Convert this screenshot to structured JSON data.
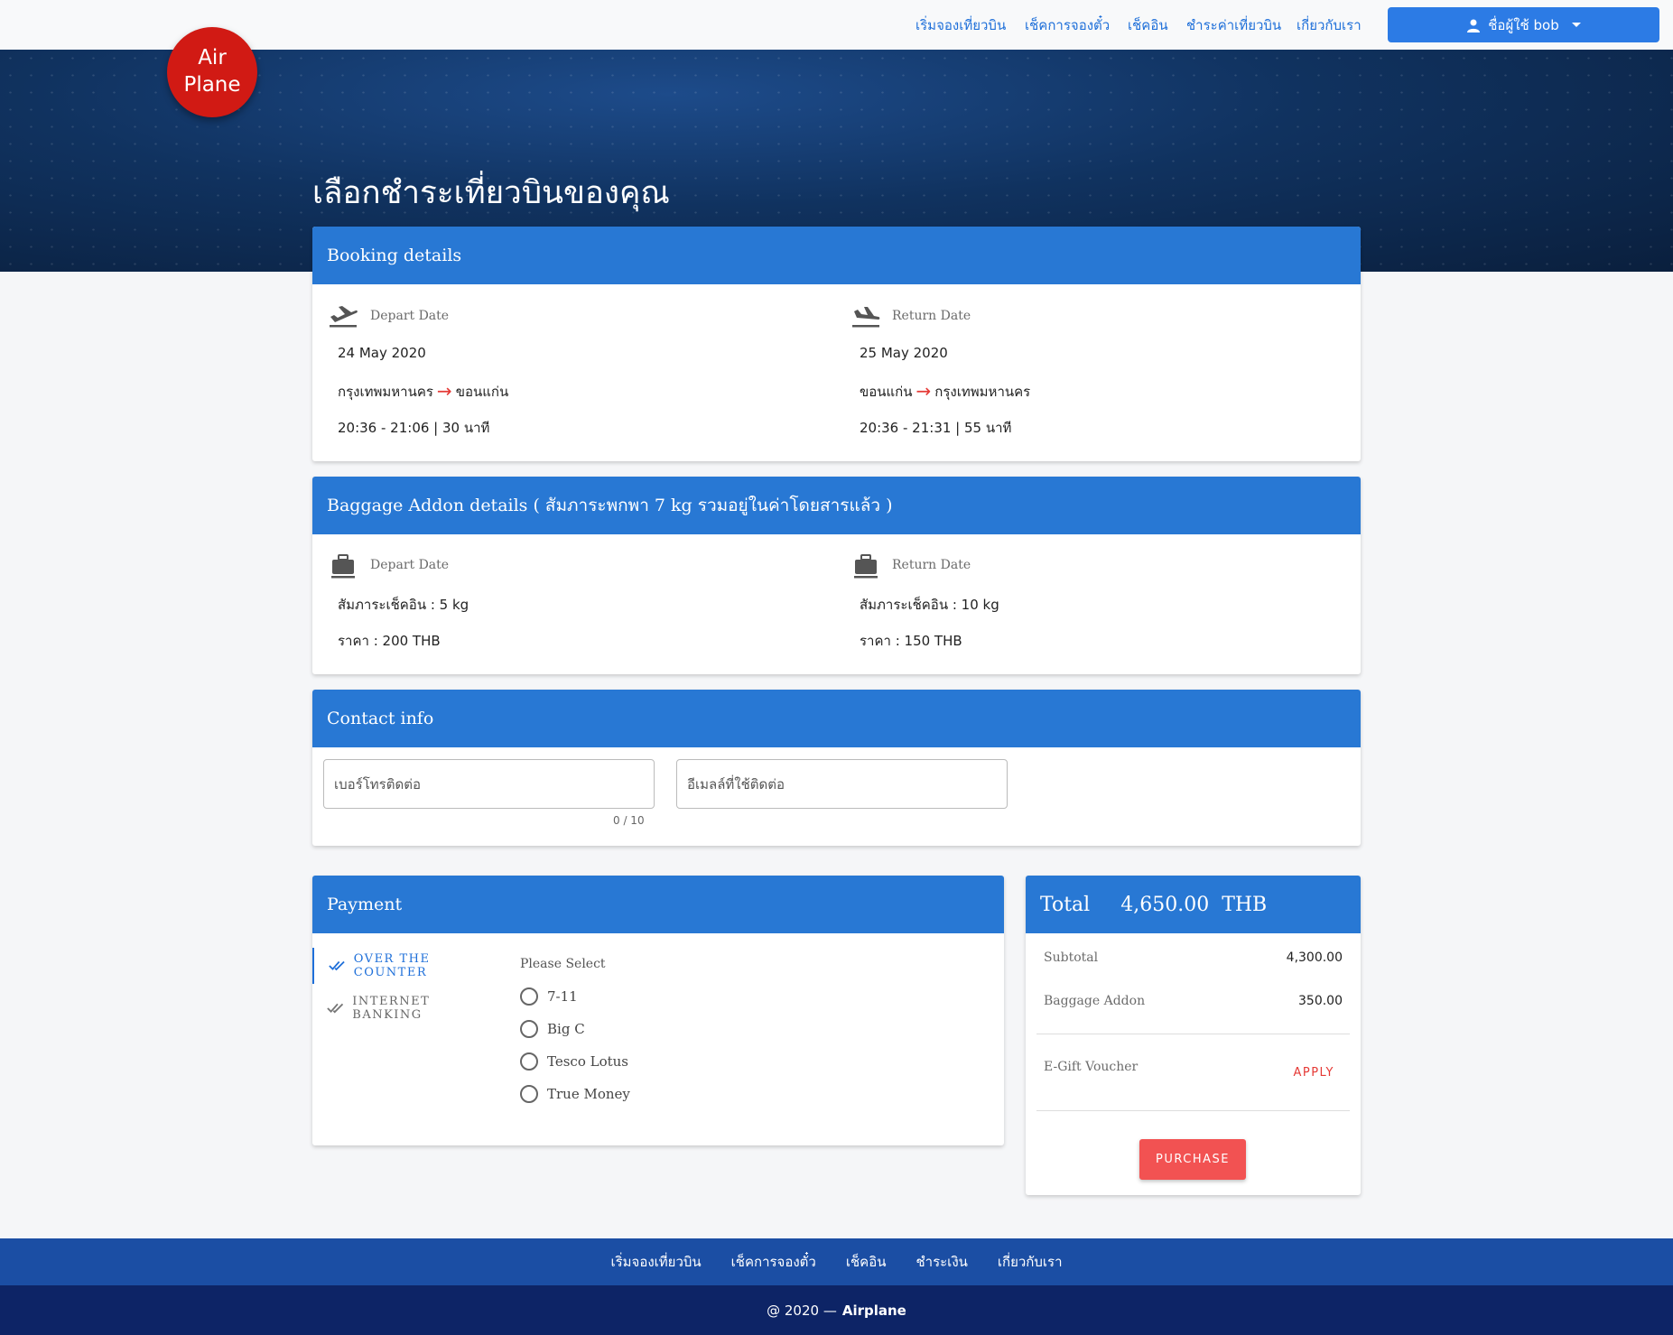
{
  "nav": {
    "links": [
      "เริ่มจองเที่ยวบิน",
      "เช็คการจองตั๋ว",
      "เช็คอิน",
      "ชำระค่าเที่ยวบิน",
      "เกี่ยวกับเรา"
    ],
    "user_label": "ชื่อผู้ใช้ bob"
  },
  "logo": {
    "line1": "Air",
    "line2": "Plane"
  },
  "page_title": "เลือกชำระเที่ยวบินของคุณ",
  "booking": {
    "title": "Booking details",
    "depart": {
      "label": "Depart Date",
      "date": "24 May 2020",
      "from": "กรุงเทพมหานคร",
      "to": "ขอนแก่น",
      "time": "20:36 - 21:06 | 30 นาที"
    },
    "return": {
      "label": "Return Date",
      "date": "25 May 2020",
      "from": "ขอนแก่น",
      "to": "กรุงเทพมหานคร",
      "time": "20:36 - 21:31 | 55 นาที"
    }
  },
  "baggage": {
    "title": "Baggage Addon details ( สัมภาระพกพา 7 kg รวมอยู่ในค่าโดยสารแล้ว )",
    "depart": {
      "label": "Depart Date",
      "weight": "สัมภาระเช็คอิน : 5 kg",
      "price": "ราคา : 200 THB"
    },
    "return": {
      "label": "Return Date",
      "weight": "สัมภาระเช็คอิน : 10 kg",
      "price": "ราคา : 150 THB"
    }
  },
  "contact": {
    "title": "Contact info",
    "phone_placeholder": "เบอร์โทรติดต่อ",
    "email_placeholder": "อีเมลล์ที่ใช้ติดต่อ",
    "phone_counter": "0 / 10"
  },
  "payment": {
    "title": "Payment",
    "tabs": [
      "OVER THE COUNTER",
      "INTERNET BANKING"
    ],
    "prompt": "Please Select",
    "options": [
      "7-11",
      "Big C",
      "Tesco Lotus",
      "True Money"
    ]
  },
  "total": {
    "label": "Total",
    "amount": "4,650.00",
    "currency": "THB",
    "subtotal_label": "Subtotal",
    "subtotal_value": "4,300.00",
    "addon_label": "Baggage Addon",
    "addon_value": "350.00",
    "voucher_label": "E-Gift Voucher",
    "apply_label": "APPLY",
    "purchase_label": "PURCHASE"
  },
  "footer": {
    "links": [
      "เริ่มจองเที่ยวบิน",
      "เช็คการจองตั๋ว",
      "เช็คอิน",
      "ชำระเงิน",
      "เกี่ยวกับเรา"
    ],
    "copyright": "@ 2020 —",
    "brand": "Airplane"
  },
  "colors": {
    "primary": "#2878d4",
    "accent_red": "#e53935",
    "logo_red": "#d11a14",
    "footer_dark": "#0d2466"
  }
}
